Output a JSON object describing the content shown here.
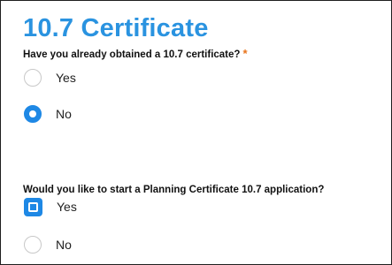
{
  "section": {
    "title": "10.7 Certificate"
  },
  "question1": {
    "text": "Have you already obtained a 10.7 certificate?",
    "required_marker": "*",
    "options": [
      {
        "label": "Yes",
        "selected": false
      },
      {
        "label": "No",
        "selected": true
      }
    ]
  },
  "question2": {
    "text": "Would you like to start a Planning Certificate 10.7 application?",
    "options": [
      {
        "label": "Yes",
        "selected": true
      },
      {
        "label": "No",
        "selected": false
      }
    ]
  },
  "colors": {
    "title": "#2a93e0",
    "accent": "#1e88e5",
    "required": "#e8731a"
  }
}
